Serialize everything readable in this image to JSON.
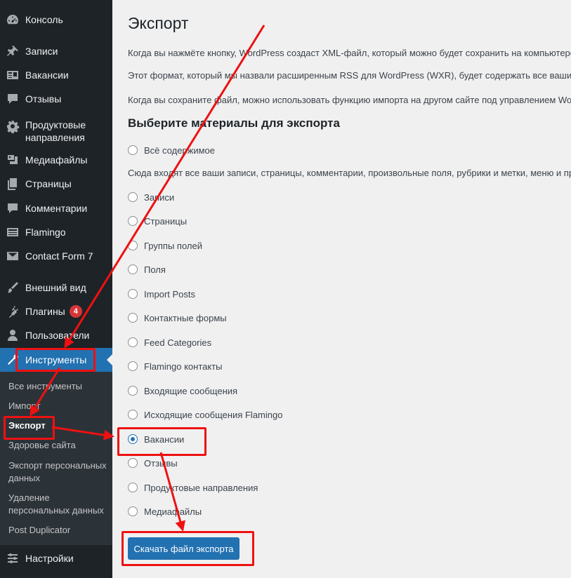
{
  "sidebar": {
    "items": [
      {
        "label": "Консоль",
        "icon": "dashboard-icon"
      },
      {
        "label": "Записи",
        "icon": "pin-icon"
      },
      {
        "label": "Вакансии",
        "icon": "vacancy-icon"
      },
      {
        "label": "Отзывы",
        "icon": "comment-icon"
      },
      {
        "label": "Продуктовые направления",
        "icon": "gear-icon"
      },
      {
        "label": "Медиафайлы",
        "icon": "media-icon"
      },
      {
        "label": "Страницы",
        "icon": "pages-icon"
      },
      {
        "label": "Комментарии",
        "icon": "comment-icon"
      },
      {
        "label": "Flamingo",
        "icon": "flamingo-icon"
      },
      {
        "label": "Contact Form 7",
        "icon": "mail-icon"
      },
      {
        "label": "Внешний вид",
        "icon": "brush-icon"
      },
      {
        "label": "Плагины",
        "icon": "plugin-icon",
        "badge": "4"
      },
      {
        "label": "Пользователи",
        "icon": "user-icon"
      },
      {
        "label": "Инструменты",
        "icon": "wrench-icon",
        "active": true
      },
      {
        "label": "Настройки",
        "icon": "settings-icon"
      }
    ],
    "submenu": [
      {
        "label": "Все инструменты"
      },
      {
        "label": "Импорт"
      },
      {
        "label": "Экспорт",
        "current": true
      },
      {
        "label": "Здоровье сайта"
      },
      {
        "label": "Экспорт персональных данных"
      },
      {
        "label": "Удаление персональных данных"
      },
      {
        "label": "Post Duplicator"
      }
    ],
    "badge_color": "#d63638",
    "active_color": "#2271b1"
  },
  "main": {
    "title": "Экспорт",
    "paragraphs": [
      "Когда вы нажмёте кнопку, WordPress создаст XML-файл, который можно будет сохранить на компьютере",
      "Этот формат, который мы назвали расширенным RSS для WordPress (WXR), будет содержать все ваши за",
      "Когда вы сохраните файл, можно использовать функцию импорта на другом сайте под управлением Wor"
    ],
    "section_title": "Выберите материалы для экспорта",
    "all_content_label": "Всё содержимое",
    "all_content_desc": "Сюда входят все ваши записи, страницы, комментарии, произвольные поля, рубрики и метки, меню и пр",
    "options": [
      {
        "label": "Записи",
        "checked": false
      },
      {
        "label": "Страницы",
        "checked": false
      },
      {
        "label": "Группы полей",
        "checked": false
      },
      {
        "label": "Поля",
        "checked": false
      },
      {
        "label": "Import Posts",
        "checked": false
      },
      {
        "label": "Контактные формы",
        "checked": false
      },
      {
        "label": "Feed Categories",
        "checked": false
      },
      {
        "label": "Flamingo контакты",
        "checked": false
      },
      {
        "label": "Входящие сообщения",
        "checked": false
      },
      {
        "label": "Исходящие сообщения Flamingo",
        "checked": false
      },
      {
        "label": "Вакансии",
        "checked": true
      },
      {
        "label": "Отзывы",
        "checked": false
      },
      {
        "label": "Продуктовые направления",
        "checked": false
      },
      {
        "label": "Медиафайлы",
        "checked": false
      }
    ],
    "download_button": "Скачать файл экспорта",
    "button_color": "#2271b1"
  },
  "annotation_color": "#ee1111"
}
